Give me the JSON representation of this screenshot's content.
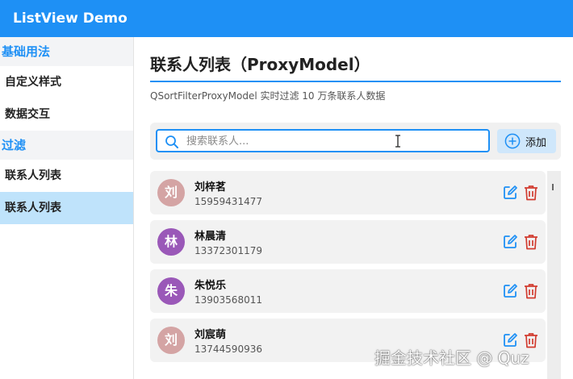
{
  "app": {
    "title": "ListView Demo"
  },
  "sidebar": {
    "groups": [
      {
        "label": "基础用法",
        "items": [
          {
            "label": "自定义样式"
          },
          {
            "label": "数据交互"
          }
        ]
      },
      {
        "label": "过滤",
        "items": [
          {
            "label": "联系人列表"
          },
          {
            "label": "联系人列表",
            "active": true
          }
        ]
      }
    ]
  },
  "main": {
    "title": "联系人列表（ProxyModel）",
    "subtitle": "QSortFilterProxyModel 实时过滤 10 万条联系人数据",
    "search": {
      "placeholder": "搜索联系人...",
      "value": ""
    },
    "add_label": "添加",
    "contacts": [
      {
        "avatar": "刘",
        "name": "刘梓茗",
        "phone": "15959431477",
        "avatar_color": "#d4a4a4"
      },
      {
        "avatar": "林",
        "name": "林晨清",
        "phone": "13372301179",
        "avatar_color": "#9a58b8"
      },
      {
        "avatar": "朱",
        "name": "朱悦乐",
        "phone": "13903568011",
        "avatar_color": "#9a58b8"
      },
      {
        "avatar": "刘",
        "name": "刘宸萌",
        "phone": "13744590936",
        "avatar_color": "#d4a4a4"
      }
    ]
  },
  "watermark": "掘金技术社区 @ Quz",
  "colors": {
    "accent": "#1e90f5",
    "active_item_bg": "#bfe3fb",
    "delete": "#d23b2f"
  },
  "icons": {
    "search": "search-icon",
    "add": "plus-circle-icon",
    "edit": "edit-icon",
    "delete": "trash-icon"
  }
}
